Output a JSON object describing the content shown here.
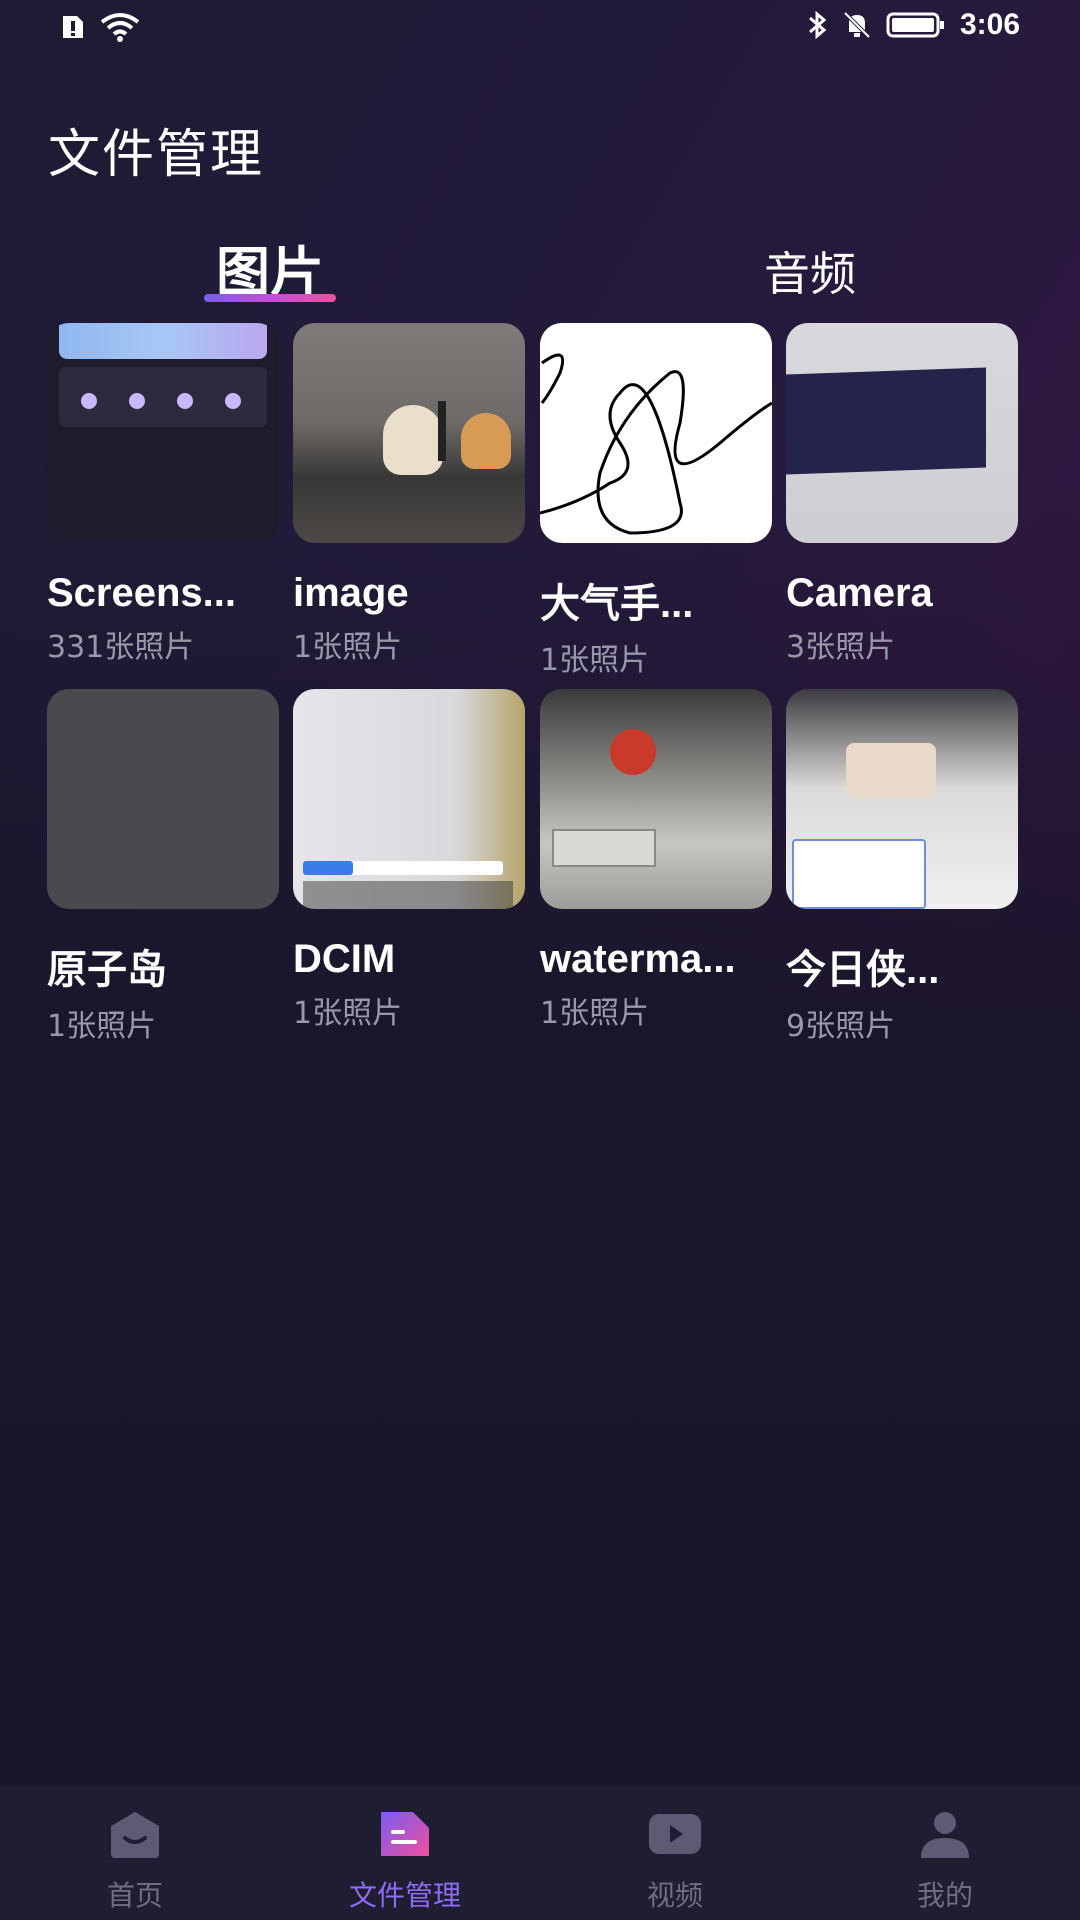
{
  "status_bar": {
    "time": "3:06",
    "icons": [
      "alert-icon",
      "wifi-icon",
      "bluetooth-icon",
      "mute-bell-icon",
      "battery-icon"
    ]
  },
  "page_title": "文件管理",
  "tabs": [
    {
      "label": "图片",
      "active": true
    },
    {
      "label": "音频",
      "active": false
    }
  ],
  "folders": [
    {
      "name": "Screens...",
      "count": "331张照片",
      "thumb": "screenshot-thumbnail"
    },
    {
      "name": "image",
      "count": "1张照片",
      "thumb": "dogs-photo-thumbnail"
    },
    {
      "name": "大气手...",
      "count": "1张照片",
      "thumb": "signature-thumbnail"
    },
    {
      "name": "Camera",
      "count": "3张照片",
      "thumb": "phone-photo-thumbnail"
    },
    {
      "name": "原子岛",
      "count": "1张照片",
      "thumb": "noise-thumbnail"
    },
    {
      "name": "DCIM",
      "count": "1张照片",
      "thumb": "checkin-photo-thumbnail"
    },
    {
      "name": "waterma...",
      "count": "1张照片",
      "thumb": "desk-photo-thumbnail"
    },
    {
      "name": "今日侠...",
      "count": "9张照片",
      "thumb": "desk-phone-thumbnail"
    }
  ],
  "bottom_nav": [
    {
      "label": "首页",
      "icon": "home-icon",
      "active": false
    },
    {
      "label": "文件管理",
      "icon": "file-manager-icon",
      "active": true
    },
    {
      "label": "视频",
      "icon": "video-icon",
      "active": false
    },
    {
      "label": "我的",
      "icon": "profile-icon",
      "active": false
    }
  ],
  "colors": {
    "accent": "#8f6cf3",
    "tab_underline_start": "#7a5cf0",
    "tab_underline_end": "#f04fa0",
    "inactive_nav": "#6f6c84",
    "count_text": "#9a98a8"
  }
}
